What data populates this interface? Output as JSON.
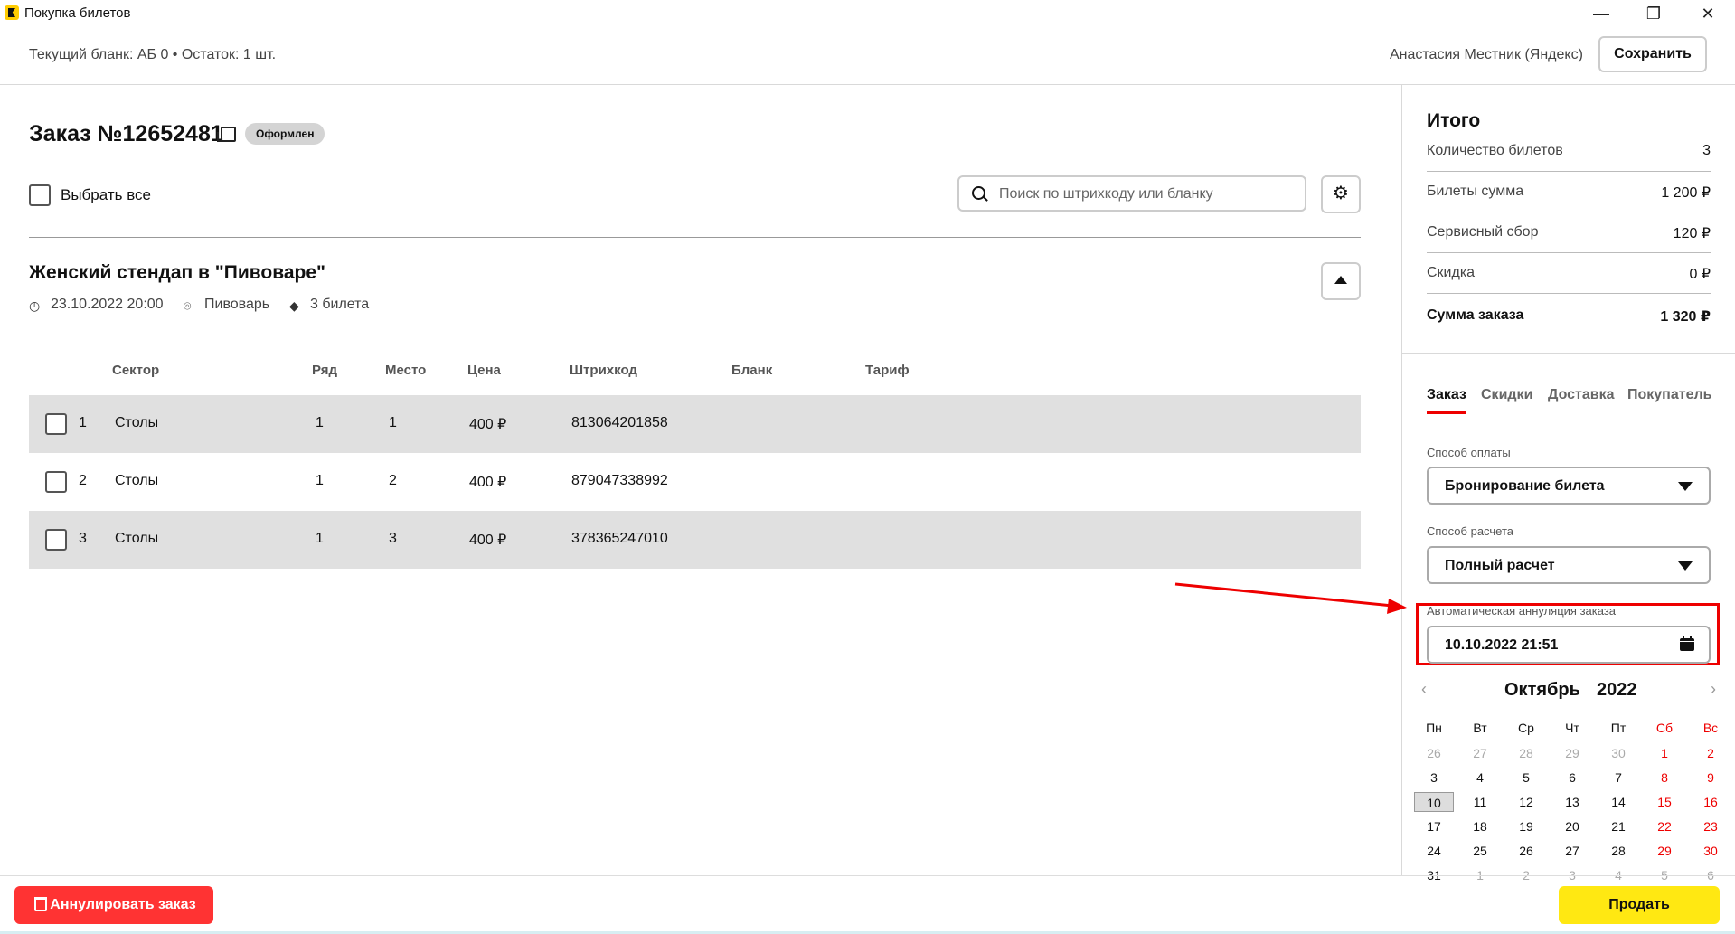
{
  "window": {
    "title": "Покупка билетов",
    "minimize": "—",
    "restore": "❐",
    "close": "✕"
  },
  "header": {
    "blank_info": "Текущий бланк: АБ 0 • Остаток: 1 шт.",
    "user": "Анастасия Местник (Яндекс)",
    "save_label": "Сохранить"
  },
  "order": {
    "title": "Заказ №12652481",
    "status": "Оформлен",
    "select_all": "Выбрать все",
    "search_placeholder": "Поиск по штрихкоду или бланку"
  },
  "event": {
    "title": "Женский стендап в \"Пивоваре\"",
    "datetime": "23.10.2022 20:00",
    "venue": "Пивоварь",
    "tickets": "3 билета"
  },
  "table": {
    "columns": [
      "Сектор",
      "Ряд",
      "Место",
      "Цена",
      "Штрихкод",
      "Бланк",
      "Тариф"
    ],
    "rows": [
      {
        "n": "1",
        "sector": "Столы",
        "row": "1",
        "seat": "1",
        "price": "400 ₽",
        "barcode": "813064201858"
      },
      {
        "n": "2",
        "sector": "Столы",
        "row": "1",
        "seat": "2",
        "price": "400 ₽",
        "barcode": "879047338992"
      },
      {
        "n": "3",
        "sector": "Столы",
        "row": "1",
        "seat": "3",
        "price": "400 ₽",
        "barcode": "378365247010"
      }
    ]
  },
  "totals": {
    "title": "Итого",
    "items": [
      {
        "label": "Количество билетов",
        "value": "3"
      },
      {
        "label": "Билеты сумма",
        "value": "1 200 ₽"
      },
      {
        "label": "Сервисный сбор",
        "value": "120 ₽"
      },
      {
        "label": "Скидка",
        "value": "0 ₽"
      }
    ],
    "sum_label": "Сумма заказа",
    "sum_value": "1 320 ₽"
  },
  "tabs": [
    "Заказ",
    "Скидки",
    "Доставка",
    "Покупатель"
  ],
  "payment": {
    "method_label": "Способ оплаты",
    "method_value": "Бронирование билета",
    "settlement_label": "Способ расчета",
    "settlement_value": "Полный расчет",
    "annul_label": "Автоматическая аннуляция заказа",
    "annul_value": "10.10.2022 21:51"
  },
  "calendar": {
    "month": "Октябрь",
    "year": "2022",
    "prev": "‹",
    "next": "›",
    "weekdays": [
      "Пн",
      "Вт",
      "Ср",
      "Чт",
      "Пт",
      "Сб",
      "Вс"
    ],
    "weeks": [
      [
        "26",
        "27",
        "28",
        "29",
        "30",
        "1",
        "2"
      ],
      [
        "3",
        "4",
        "5",
        "6",
        "7",
        "8",
        "9"
      ],
      [
        "10",
        "11",
        "12",
        "13",
        "14",
        "15",
        "16"
      ],
      [
        "17",
        "18",
        "19",
        "20",
        "21",
        "22",
        "23"
      ],
      [
        "24",
        "25",
        "26",
        "27",
        "28",
        "29",
        "30"
      ],
      [
        "31",
        "1",
        "2",
        "3",
        "4",
        "5",
        "6"
      ]
    ],
    "selected": "10"
  },
  "footer": {
    "cancel_label": "Аннулировать заказ",
    "sell_label": "Продать"
  },
  "colors": {
    "accent_red": "#e00000",
    "sell_yellow": "#ffe812",
    "cancel_red": "#ff3333"
  }
}
